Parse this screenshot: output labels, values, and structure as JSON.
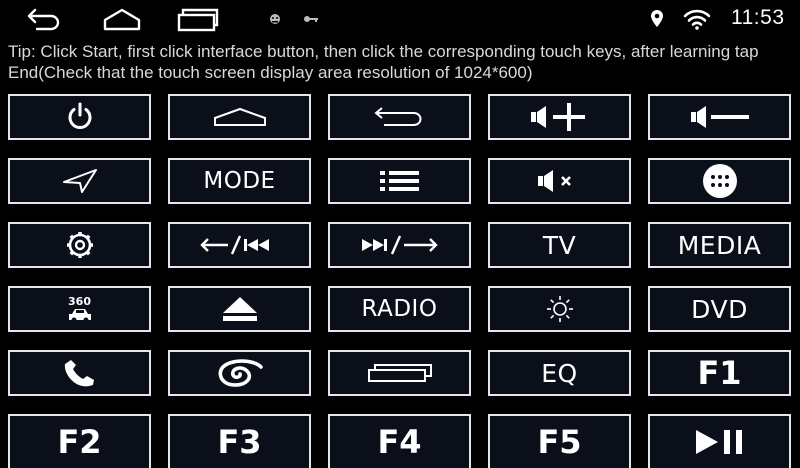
{
  "status_bar": {
    "time": "11:53",
    "nav_icons": [
      "back-icon",
      "home-icon",
      "recent-apps-icon"
    ],
    "notification_icons": [
      "android-debug-icon",
      "key-icon"
    ],
    "system_icons": [
      "location-icon",
      "wifi-icon"
    ]
  },
  "tip": "Tip: Click Start, first click interface button, then click the corresponding touch keys, after learning tap End(Check that the touch screen display area resolution of 1024*600)",
  "keys": [
    {
      "icon": "power-icon",
      "label": ""
    },
    {
      "icon": "home-icon",
      "label": ""
    },
    {
      "icon": "back-icon",
      "label": ""
    },
    {
      "icon": "volume-up-icon",
      "label": ""
    },
    {
      "icon": "volume-down-icon",
      "label": ""
    },
    {
      "icon": "navigation-icon",
      "label": ""
    },
    {
      "icon": "",
      "label": "MODE"
    },
    {
      "icon": "menu-list-icon",
      "label": ""
    },
    {
      "icon": "mute-icon",
      "label": ""
    },
    {
      "icon": "apps-icon",
      "label": ""
    },
    {
      "icon": "settings-icon",
      "label": ""
    },
    {
      "icon": "previous-track-icon",
      "label": ""
    },
    {
      "icon": "next-track-icon",
      "label": ""
    },
    {
      "icon": "",
      "label": "TV"
    },
    {
      "icon": "",
      "label": "MEDIA"
    },
    {
      "icon": "camera-360-icon",
      "label": "360"
    },
    {
      "icon": "eject-icon",
      "label": ""
    },
    {
      "icon": "",
      "label": "RADIO"
    },
    {
      "icon": "brightness-icon",
      "label": ""
    },
    {
      "icon": "",
      "label": "DVD"
    },
    {
      "icon": "phone-icon",
      "label": ""
    },
    {
      "icon": "swirl-icon",
      "label": ""
    },
    {
      "icon": "recent-apps-icon",
      "label": ""
    },
    {
      "icon": "",
      "label": "EQ"
    },
    {
      "icon": "",
      "label": "F1"
    },
    {
      "icon": "",
      "label": "F2"
    },
    {
      "icon": "",
      "label": "F3"
    },
    {
      "icon": "",
      "label": "F4"
    },
    {
      "icon": "",
      "label": "F5"
    },
    {
      "icon": "play-pause-icon",
      "label": ""
    }
  ]
}
